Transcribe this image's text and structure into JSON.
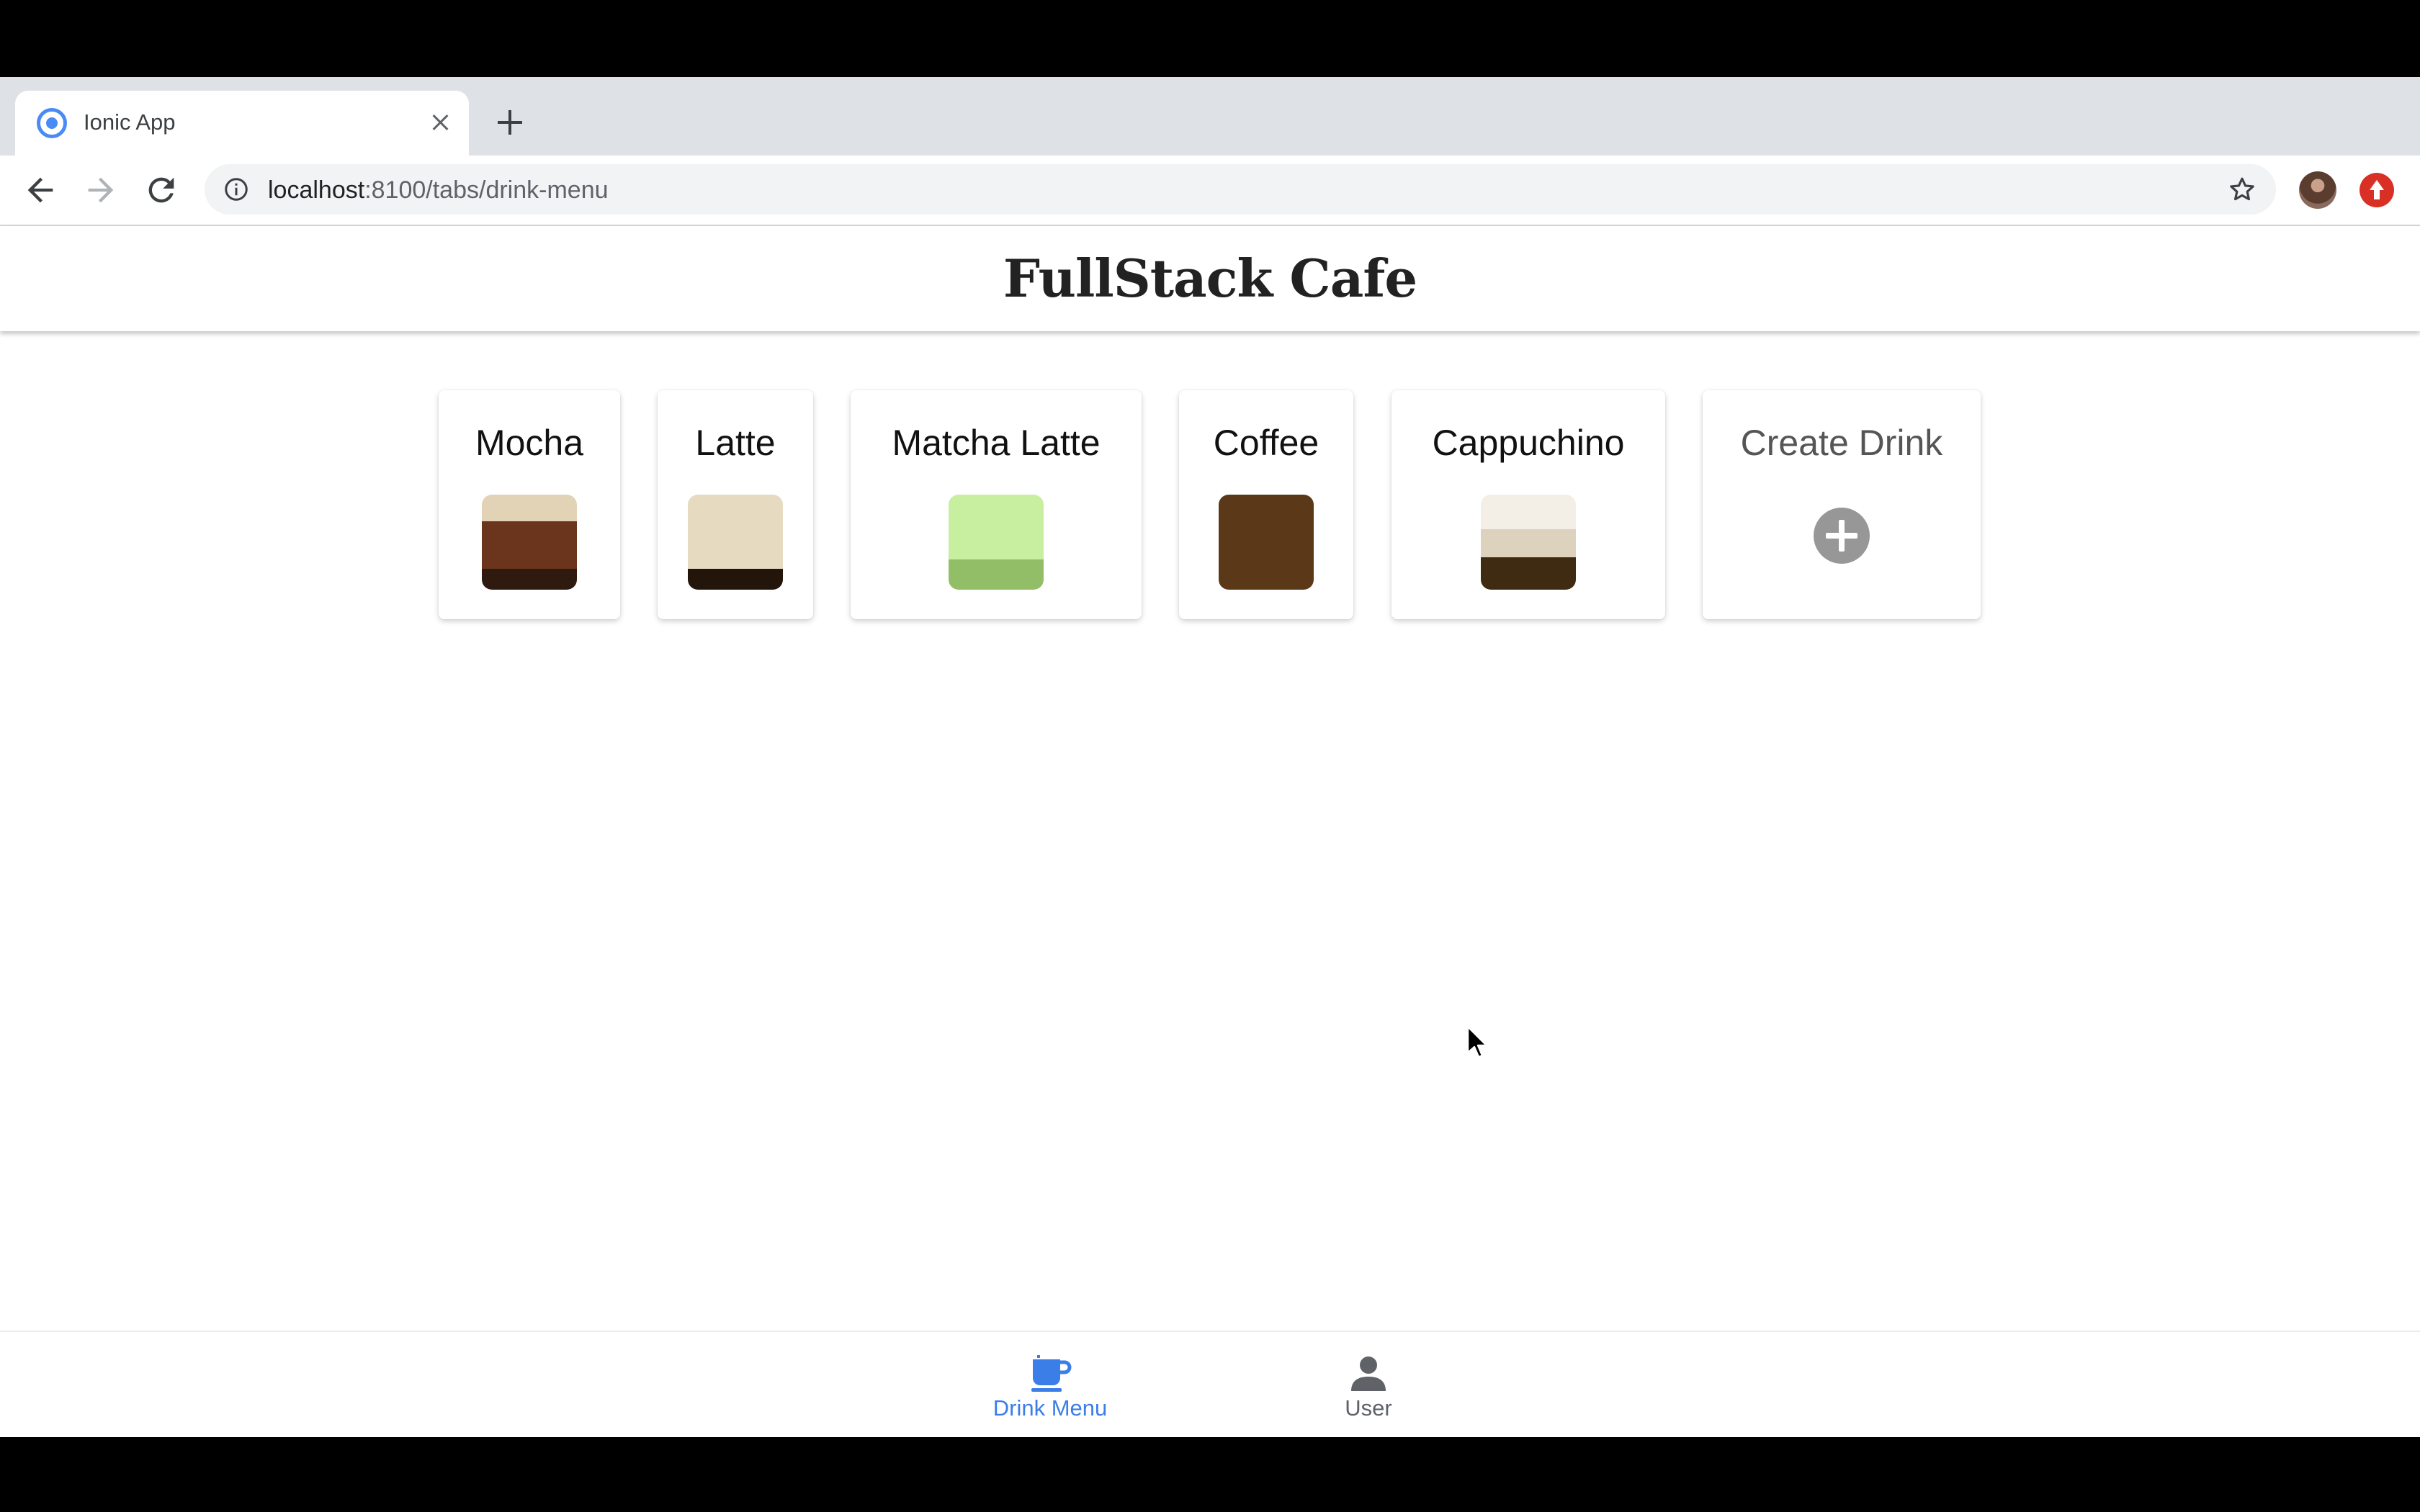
{
  "browser": {
    "tab_title": "Ionic App",
    "url_host": "localhost",
    "url_rest": ":8100/tabs/drink-menu"
  },
  "app": {
    "title": "FullStack Cafe"
  },
  "drinks": [
    {
      "name": "Mocha",
      "layers": [
        {
          "color": "#e2d3b6",
          "fraction": 0.28
        },
        {
          "color": "#6b341c",
          "fraction": 0.5
        },
        {
          "color": "#2e1a0e",
          "fraction": 0.22
        }
      ]
    },
    {
      "name": "Latte",
      "layers": [
        {
          "color": "#e6dbc1",
          "fraction": 0.78
        },
        {
          "color": "#24150b",
          "fraction": 0.22
        }
      ]
    },
    {
      "name": "Matcha Latte",
      "layers": [
        {
          "color": "#c8eea0",
          "fraction": 0.68
        },
        {
          "color": "#92be68",
          "fraction": 0.32
        }
      ]
    },
    {
      "name": "Coffee",
      "layers": [
        {
          "color": "#5a3818",
          "fraction": 1.0
        }
      ]
    },
    {
      "name": "Cappuchino",
      "layers": [
        {
          "color": "#f3efe6",
          "fraction": 0.36
        },
        {
          "color": "#ddd2bd",
          "fraction": 0.3
        },
        {
          "color": "#3e2b12",
          "fraction": 0.34
        }
      ]
    }
  ],
  "create_card": {
    "label": "Create Drink",
    "icon": "add-circle-icon"
  },
  "tabs": {
    "drink_menu": {
      "label": "Drink Menu",
      "icon": "cafe-icon",
      "active": true
    },
    "user": {
      "label": "User",
      "icon": "person-icon",
      "active": false
    }
  },
  "colors": {
    "accent": "#3b7ee8",
    "plus_icon": "#979797"
  }
}
